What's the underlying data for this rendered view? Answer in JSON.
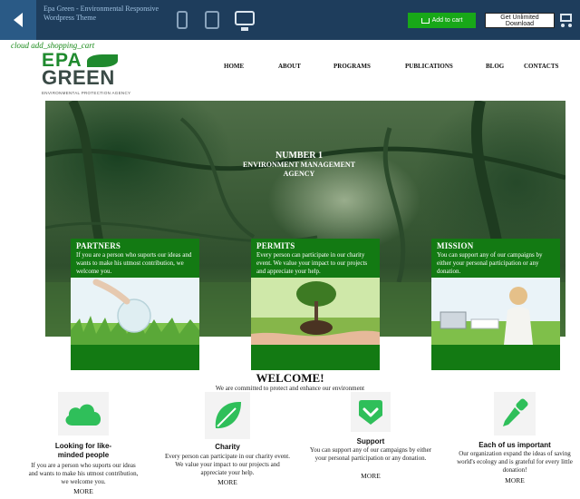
{
  "preview_bar": {
    "theme_title": "Epa Green - Environmental Responsive Wordpress Theme",
    "add_to_cart_label": "Add to cart",
    "unlimited_download_label": "Get Unlimited Download"
  },
  "stray_text": "cloud add_shopping_cart",
  "logo": {
    "line1": "EPA",
    "line2": "GREEN",
    "tagline": "ENVIRONMENTAL PROTECTION AGENCY"
  },
  "nav": [
    "HOME",
    "ABOUT",
    "PROGRAMS",
    "PUBLICATIONS",
    "BLOG",
    "CONTACTS"
  ],
  "hero": {
    "line1": "NUMBER 1",
    "line2": "ENVIRONMENT MANAGEMENT",
    "line3": "AGENCY"
  },
  "cards": [
    {
      "title": "PARTNERS",
      "text": "If you are a person who suports our ideas and wants to make his utmost contribution, we welcome you."
    },
    {
      "title": "PERMITS",
      "text": "Every person can participate in our charity event. We value your impact to our projects and appreciate your help."
    },
    {
      "title": "MISSION",
      "text": "You can support any of our campaigns by either your personal participation or any donation."
    }
  ],
  "welcome": {
    "title": "WELCOME!",
    "subtitle": "We are committed to protect and enhance our environment"
  },
  "features": [
    {
      "icon": "cloud-icon",
      "title_l1": "Looking for like-",
      "title_l2": "minded people",
      "text": "If you are a person who suports our ideas and wants to make his utmost contribution, we welcome you.",
      "more": "MORE"
    },
    {
      "icon": "leaf-icon",
      "title_l1": "Charity",
      "title_l2": "",
      "text": "Every person can participate in our charity event. We value your impact to our projects and appreciate your help.",
      "more": "MORE"
    },
    {
      "icon": "check-shield-icon",
      "title_l1": "Support",
      "title_l2": "",
      "text": "You can support any of our campaigns by either your personal participation or any donation.",
      "more": "MORE"
    },
    {
      "icon": "dropper-icon",
      "title_l1": "Each of us important",
      "title_l2": "",
      "text": "Our organization expand the ideas of saving world's ecology and is grateful for every little donation!",
      "more": "MORE"
    }
  ],
  "colors": {
    "brand_green": "#137a13",
    "icon_green": "#2fbf5a",
    "preview_bar": "#1e3d5c"
  }
}
